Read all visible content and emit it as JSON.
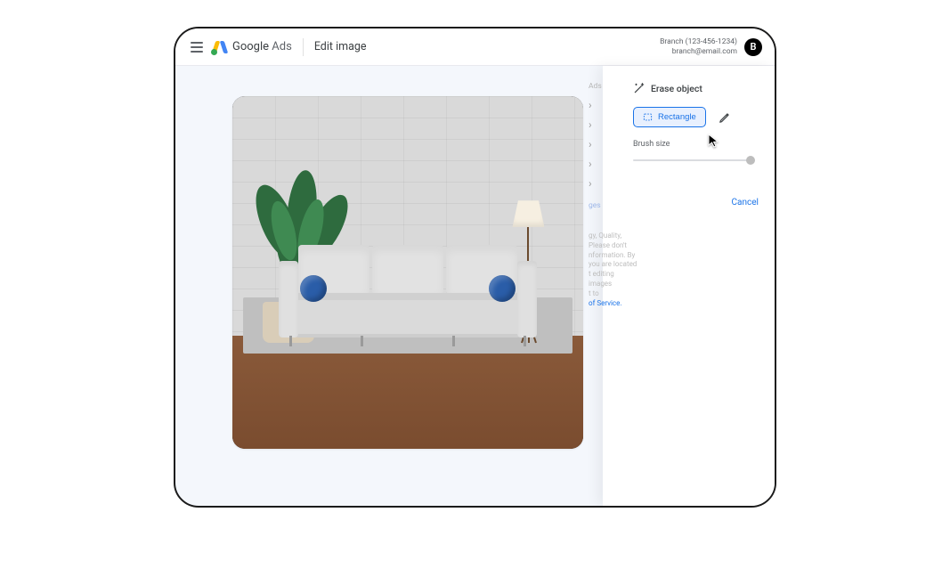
{
  "header": {
    "brand_primary": "Google",
    "brand_secondary": "Ads",
    "page_title": "Edit image",
    "account_name": "Branch (123-456-1234)",
    "account_email": "branch@email.com",
    "avatar_initial": "B"
  },
  "ghost_panel": {
    "label": "Ads",
    "side_text_lines": [
      "gy, Quality,",
      "Please don't",
      "nformation. By",
      "you are located",
      "t editing images",
      "t to"
    ],
    "terms_link": "of Service.",
    "bottom_link_partial": "ges"
  },
  "erase_panel": {
    "title": "Erase object",
    "rectangle_label": "Rectangle",
    "brush_label": "Brush size",
    "cancel_label": "Cancel",
    "brush_value": 100
  },
  "icons": {
    "menu": "menu-icon",
    "wand": "magic-wand-icon",
    "rectangle": "rectangle-select-icon",
    "pencil": "pencil-icon",
    "chevron": "chevron-right-icon",
    "cursor": "cursor-arrow-icon"
  }
}
